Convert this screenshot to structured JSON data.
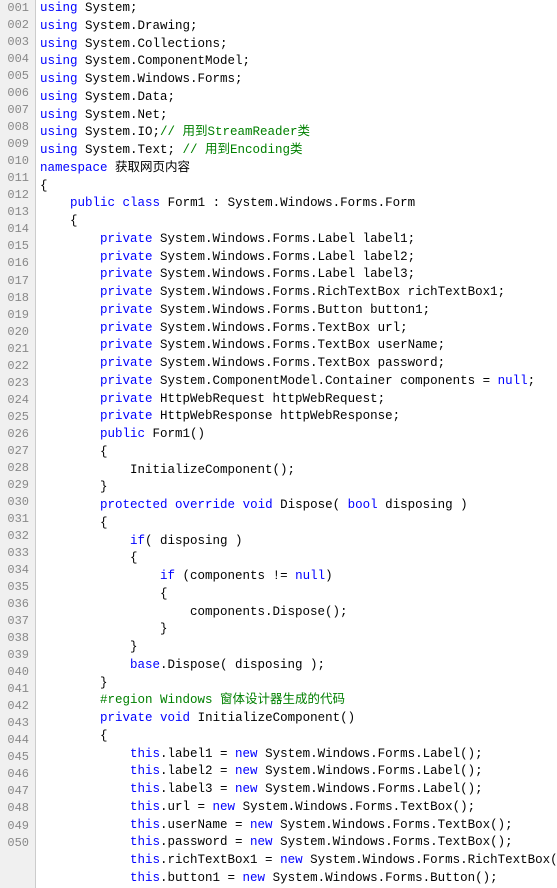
{
  "lines": [
    {
      "num": "001",
      "content": [
        {
          "t": "kw",
          "v": "using"
        },
        {
          "t": "nm",
          "v": " System;"
        }
      ]
    },
    {
      "num": "002",
      "content": [
        {
          "t": "kw",
          "v": "using"
        },
        {
          "t": "nm",
          "v": " System.Drawing;"
        }
      ]
    },
    {
      "num": "003",
      "content": [
        {
          "t": "kw",
          "v": "using"
        },
        {
          "t": "nm",
          "v": " System.Collections;"
        }
      ]
    },
    {
      "num": "004",
      "content": [
        {
          "t": "kw",
          "v": "using"
        },
        {
          "t": "nm",
          "v": " System.ComponentModel;"
        }
      ]
    },
    {
      "num": "005",
      "content": [
        {
          "t": "kw",
          "v": "using"
        },
        {
          "t": "nm",
          "v": " System.Windows.Forms;"
        }
      ]
    },
    {
      "num": "006",
      "content": [
        {
          "t": "kw",
          "v": "using"
        },
        {
          "t": "nm",
          "v": " System.Data;"
        }
      ]
    },
    {
      "num": "007",
      "content": [
        {
          "t": "kw",
          "v": "using"
        },
        {
          "t": "nm",
          "v": " System.Net;"
        }
      ]
    },
    {
      "num": "008",
      "content": [
        {
          "t": "kw",
          "v": "using"
        },
        {
          "t": "nm",
          "v": " System.IO;"
        },
        {
          "t": "cm",
          "v": "// 用到StreamReader类"
        }
      ]
    },
    {
      "num": "009",
      "content": [
        {
          "t": "kw",
          "v": "using"
        },
        {
          "t": "nm",
          "v": " System.Text;"
        },
        {
          "t": "cm",
          "v": " // 用到Encoding类"
        }
      ]
    },
    {
      "num": "010",
      "content": [
        {
          "t": "kw",
          "v": "namespace"
        },
        {
          "t": "nm",
          "v": " 获取网页内容"
        }
      ]
    },
    {
      "num": "011",
      "content": [
        {
          "t": "nm",
          "v": "{"
        }
      ]
    },
    {
      "num": "012",
      "content": [
        {
          "t": "nm",
          "v": "    "
        },
        {
          "t": "kw",
          "v": "public"
        },
        {
          "t": "nm",
          "v": " "
        },
        {
          "t": "kw",
          "v": "class"
        },
        {
          "t": "nm",
          "v": " Form1 : System.Windows.Forms.Form"
        }
      ]
    },
    {
      "num": "013",
      "content": [
        {
          "t": "nm",
          "v": "    {"
        }
      ]
    },
    {
      "num": "014",
      "content": [
        {
          "t": "nm",
          "v": "        "
        },
        {
          "t": "kw",
          "v": "private"
        },
        {
          "t": "nm",
          "v": " System.Windows.Forms.Label label1;"
        }
      ]
    },
    {
      "num": "015",
      "content": [
        {
          "t": "nm",
          "v": "        "
        },
        {
          "t": "kw",
          "v": "private"
        },
        {
          "t": "nm",
          "v": " System.Windows.Forms.Label label2;"
        }
      ]
    },
    {
      "num": "016",
      "content": [
        {
          "t": "nm",
          "v": "        "
        },
        {
          "t": "kw",
          "v": "private"
        },
        {
          "t": "nm",
          "v": " System.Windows.Forms.Label label3;"
        }
      ]
    },
    {
      "num": "017",
      "content": [
        {
          "t": "nm",
          "v": "        "
        },
        {
          "t": "kw",
          "v": "private"
        },
        {
          "t": "nm",
          "v": " System.Windows.Forms.RichTextBox richTextBox1;"
        }
      ]
    },
    {
      "num": "018",
      "content": [
        {
          "t": "nm",
          "v": "        "
        },
        {
          "t": "kw",
          "v": "private"
        },
        {
          "t": "nm",
          "v": " System.Windows.Forms.Button button1;"
        }
      ]
    },
    {
      "num": "019",
      "content": [
        {
          "t": "nm",
          "v": "        "
        },
        {
          "t": "kw",
          "v": "private"
        },
        {
          "t": "nm",
          "v": " System.Windows.Forms.TextBox url;"
        }
      ]
    },
    {
      "num": "020",
      "content": [
        {
          "t": "nm",
          "v": "        "
        },
        {
          "t": "kw",
          "v": "private"
        },
        {
          "t": "nm",
          "v": " System.Windows.Forms.TextBox userName;"
        }
      ]
    },
    {
      "num": "021",
      "content": [
        {
          "t": "nm",
          "v": "        "
        },
        {
          "t": "kw",
          "v": "private"
        },
        {
          "t": "nm",
          "v": " System.Windows.Forms.TextBox password;"
        }
      ]
    },
    {
      "num": "022",
      "content": [
        {
          "t": "nm",
          "v": "        "
        },
        {
          "t": "kw",
          "v": "private"
        },
        {
          "t": "nm",
          "v": " System.ComponentModel.Container components = "
        },
        {
          "t": "kw",
          "v": "null"
        },
        {
          "t": "nm",
          "v": ";"
        }
      ]
    },
    {
      "num": "023",
      "content": [
        {
          "t": "nm",
          "v": "        "
        },
        {
          "t": "kw",
          "v": "private"
        },
        {
          "t": "nm",
          "v": " HttpWebRequest httpWebRequest;"
        }
      ]
    },
    {
      "num": "024",
      "content": [
        {
          "t": "nm",
          "v": "        "
        },
        {
          "t": "kw",
          "v": "private"
        },
        {
          "t": "nm",
          "v": " HttpWebResponse httpWebResponse;"
        }
      ]
    },
    {
      "num": "025",
      "content": [
        {
          "t": "nm",
          "v": "        "
        },
        {
          "t": "kw",
          "v": "public"
        },
        {
          "t": "nm",
          "v": " Form1()"
        }
      ]
    },
    {
      "num": "026",
      "content": [
        {
          "t": "nm",
          "v": "        {"
        }
      ]
    },
    {
      "num": "027",
      "content": [
        {
          "t": "nm",
          "v": "            InitializeComponent();"
        }
      ]
    },
    {
      "num": "028",
      "content": [
        {
          "t": "nm",
          "v": "        }"
        }
      ]
    },
    {
      "num": "029",
      "content": [
        {
          "t": "nm",
          "v": "        "
        },
        {
          "t": "kw",
          "v": "protected"
        },
        {
          "t": "nm",
          "v": " "
        },
        {
          "t": "kw",
          "v": "override"
        },
        {
          "t": "nm",
          "v": " "
        },
        {
          "t": "kw",
          "v": "void"
        },
        {
          "t": "nm",
          "v": " Dispose( "
        },
        {
          "t": "kw",
          "v": "bool"
        },
        {
          "t": "nm",
          "v": " disposing )"
        }
      ]
    },
    {
      "num": "030",
      "content": [
        {
          "t": "nm",
          "v": "        {"
        }
      ]
    },
    {
      "num": "031",
      "content": [
        {
          "t": "nm",
          "v": "            "
        },
        {
          "t": "kw",
          "v": "if"
        },
        {
          "t": "nm",
          "v": "( disposing )"
        }
      ]
    },
    {
      "num": "032",
      "content": [
        {
          "t": "nm",
          "v": "            {"
        }
      ]
    },
    {
      "num": "033",
      "content": [
        {
          "t": "nm",
          "v": "                "
        },
        {
          "t": "kw",
          "v": "if"
        },
        {
          "t": "nm",
          "v": " (components != "
        },
        {
          "t": "kw",
          "v": "null"
        },
        {
          "t": "nm",
          "v": ")"
        }
      ]
    },
    {
      "num": "034",
      "content": [
        {
          "t": "nm",
          "v": "                {"
        }
      ]
    },
    {
      "num": "035",
      "content": [
        {
          "t": "nm",
          "v": "                    components.Dispose();"
        }
      ]
    },
    {
      "num": "036",
      "content": [
        {
          "t": "nm",
          "v": "                }"
        }
      ]
    },
    {
      "num": "037",
      "content": [
        {
          "t": "nm",
          "v": "            }"
        }
      ]
    },
    {
      "num": "038",
      "content": [
        {
          "t": "nm",
          "v": "            "
        },
        {
          "t": "kw",
          "v": "base"
        },
        {
          "t": "nm",
          "v": ".Dispose( disposing );"
        }
      ]
    },
    {
      "num": "039",
      "content": [
        {
          "t": "nm",
          "v": "        }"
        }
      ]
    },
    {
      "num": "040",
      "content": [
        {
          "t": "cm",
          "v": "        #region Windows 窗体设计器生成的代码"
        }
      ]
    },
    {
      "num": "041",
      "content": [
        {
          "t": "nm",
          "v": "        "
        },
        {
          "t": "kw",
          "v": "private"
        },
        {
          "t": "nm",
          "v": " "
        },
        {
          "t": "kw",
          "v": "void"
        },
        {
          "t": "nm",
          "v": " InitializeComponent()"
        }
      ]
    },
    {
      "num": "042",
      "content": [
        {
          "t": "nm",
          "v": "        {"
        }
      ]
    },
    {
      "num": "043",
      "content": [
        {
          "t": "nm",
          "v": "            "
        },
        {
          "t": "kw",
          "v": "this"
        },
        {
          "t": "nm",
          "v": ".label1 = "
        },
        {
          "t": "kw",
          "v": "new"
        },
        {
          "t": "nm",
          "v": " System.Windows.Forms.Label();"
        }
      ]
    },
    {
      "num": "044",
      "content": [
        {
          "t": "nm",
          "v": "            "
        },
        {
          "t": "kw",
          "v": "this"
        },
        {
          "t": "nm",
          "v": ".label2 = "
        },
        {
          "t": "kw",
          "v": "new"
        },
        {
          "t": "nm",
          "v": " System.Windows.Forms.Label();"
        }
      ]
    },
    {
      "num": "045",
      "content": [
        {
          "t": "nm",
          "v": "            "
        },
        {
          "t": "kw",
          "v": "this"
        },
        {
          "t": "nm",
          "v": ".label3 = "
        },
        {
          "t": "kw",
          "v": "new"
        },
        {
          "t": "nm",
          "v": " System.Windows.Forms.Label();"
        }
      ]
    },
    {
      "num": "046",
      "content": [
        {
          "t": "nm",
          "v": "            "
        },
        {
          "t": "kw",
          "v": "this"
        },
        {
          "t": "nm",
          "v": ".url = "
        },
        {
          "t": "kw",
          "v": "new"
        },
        {
          "t": "nm",
          "v": " System.Windows.Forms.TextBox();"
        }
      ]
    },
    {
      "num": "047",
      "content": [
        {
          "t": "nm",
          "v": "            "
        },
        {
          "t": "kw",
          "v": "this"
        },
        {
          "t": "nm",
          "v": ".userName = "
        },
        {
          "t": "kw",
          "v": "new"
        },
        {
          "t": "nm",
          "v": " System.Windows.Forms.TextBox();"
        }
      ]
    },
    {
      "num": "048",
      "content": [
        {
          "t": "nm",
          "v": "            "
        },
        {
          "t": "kw",
          "v": "this"
        },
        {
          "t": "nm",
          "v": ".password = "
        },
        {
          "t": "kw",
          "v": "new"
        },
        {
          "t": "nm",
          "v": " System.Windows.Forms.TextBox();"
        }
      ]
    },
    {
      "num": "049",
      "content": [
        {
          "t": "nm",
          "v": "            "
        },
        {
          "t": "kw",
          "v": "this"
        },
        {
          "t": "nm",
          "v": ".richTextBox1 = "
        },
        {
          "t": "kw",
          "v": "new"
        },
        {
          "t": "nm",
          "v": " System.Windows.Forms.RichTextBox();"
        }
      ]
    },
    {
      "num": "050",
      "content": [
        {
          "t": "nm",
          "v": "            "
        },
        {
          "t": "kw",
          "v": "this"
        },
        {
          "t": "nm",
          "v": ".button1 = "
        },
        {
          "t": "kw",
          "v": "new"
        },
        {
          "t": "nm",
          "v": " System.Windows.Forms.Button();"
        }
      ]
    }
  ]
}
